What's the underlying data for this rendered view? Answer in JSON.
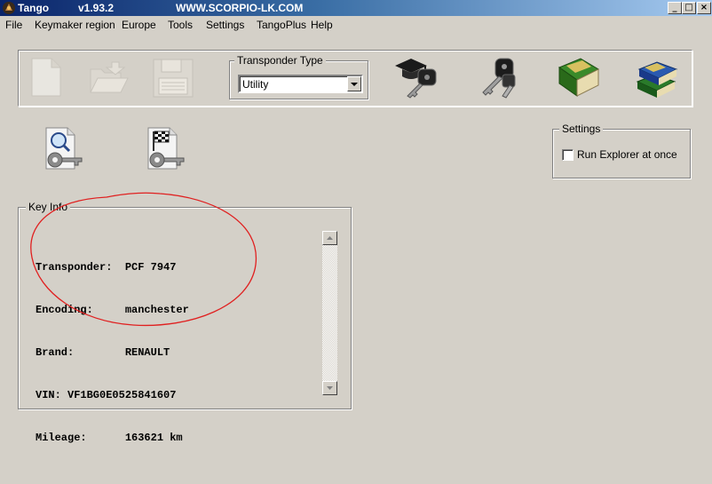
{
  "window": {
    "title": "Tango",
    "version": "v1.93.2",
    "url": "WWW.SCORPIO-LK.COM",
    "controls": [
      "_",
      "□",
      "×"
    ]
  },
  "menu": [
    "File",
    "Keymaker region",
    "Europe",
    "Tools",
    "Settings",
    "TangoPlus",
    "Help"
  ],
  "toolbar": {
    "transponder_type_label": "Transponder Type",
    "transponder_type_value": "Utility",
    "icons": [
      "new-file-icon",
      "open-folder-icon",
      "save-icon",
      "key-graduation-cap-icon",
      "keys-icon",
      "green-book-icon",
      "books-icon"
    ]
  },
  "actions": {
    "icons": [
      "search-key-document-icon",
      "checkered-flag-key-document-icon"
    ]
  },
  "settings": {
    "group_label": "Settings",
    "run_explorer_label": "Run Explorer at once",
    "run_explorer_checked": false
  },
  "key_info": {
    "group_label": "Key Info",
    "lines": [
      "Transponder:  PCF 7947",
      "Encoding:     manchester",
      "Brand:        RENAULT",
      "VIN: VF1BG0E0525841607",
      "Mileage:      163621 km"
    ]
  },
  "annotation_color": "#e02020"
}
